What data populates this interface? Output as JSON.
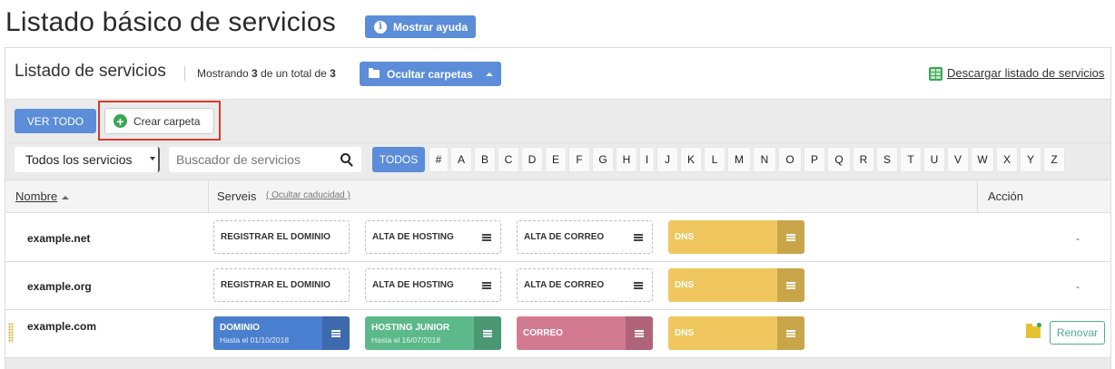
{
  "page": {
    "title": "Listado básico de servicios",
    "help_label": "Mostrar ayuda",
    "help_icon": "info-icon"
  },
  "panel": {
    "title": "Listado de servicios",
    "showing_prefix": "Mostrando",
    "showing_count": "3",
    "showing_middle": "de un total de",
    "showing_total": "3",
    "hide_folders_label": "Ocultar carpetas",
    "download_label": "Descargar listado de servicios"
  },
  "toolbar": {
    "ver_todo_label": "VER TODO",
    "crear_label": "Crear carpeta",
    "highlight_color": "#d63a2a"
  },
  "filters": {
    "select_value": "Todos los servicios",
    "search_placeholder": "Buscador de servicios",
    "todos_label": "TODOS",
    "letters": [
      "#",
      "A",
      "B",
      "C",
      "D",
      "E",
      "F",
      "G",
      "H",
      "I",
      "J",
      "K",
      "L",
      "M",
      "N",
      "O",
      "P",
      "Q",
      "R",
      "S",
      "T",
      "U",
      "V",
      "W",
      "X",
      "Y",
      "Z"
    ]
  },
  "table": {
    "col_name": "Nombre",
    "col_services": "Serveis",
    "hide_expiry": "( Ocultar caducidad )",
    "col_action": "Acción",
    "rows": [
      {
        "domain": "example.net",
        "action": "-",
        "services": [
          {
            "label": "REGISTRAR EL DOMINIO",
            "style": "dashed",
            "menu": false
          },
          {
            "label": "ALTA DE HOSTING",
            "style": "dashed",
            "menu": true
          },
          {
            "label": "ALTA DE CORREO",
            "style": "dashed",
            "menu": true
          },
          {
            "label": "DNS",
            "style": "fill",
            "color": "#efc75e",
            "menu_color": "#c9a54a",
            "menu": true
          }
        ]
      },
      {
        "domain": "example.org",
        "action": "-",
        "services": [
          {
            "label": "REGISTRAR EL DOMINIO",
            "style": "dashed",
            "menu": false
          },
          {
            "label": "ALTA DE HOSTING",
            "style": "dashed",
            "menu": true
          },
          {
            "label": "ALTA DE CORREO",
            "style": "dashed",
            "menu": true
          },
          {
            "label": "DNS",
            "style": "fill",
            "color": "#efc75e",
            "menu_color": "#c9a54a",
            "menu": true
          }
        ]
      },
      {
        "domain": "example.com",
        "renew_label": "Renovar",
        "services": [
          {
            "label": "DOMINIO",
            "sub": "Hasta el 01/10/2018",
            "style": "fill",
            "color": "#4a7fd0",
            "menu_color": "#3d69ad",
            "menu": true
          },
          {
            "label": "HOSTING JUNIOR",
            "sub": "Hasta el 16/07/2018",
            "style": "fill",
            "color": "#5bb98a",
            "menu_color": "#4a9872",
            "menu": true
          },
          {
            "label": "CORREO",
            "style": "fill",
            "color": "#d37a93",
            "menu_color": "#b0647a",
            "menu": true
          },
          {
            "label": "DNS",
            "style": "fill",
            "color": "#efc75e",
            "menu_color": "#c9a54a",
            "menu": true
          }
        ]
      }
    ]
  }
}
